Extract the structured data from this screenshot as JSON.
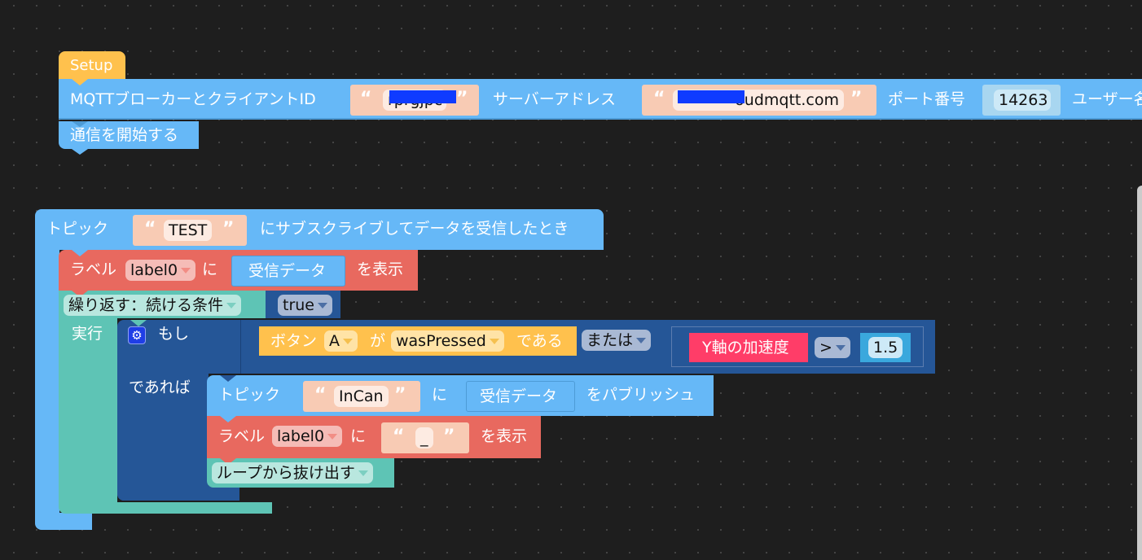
{
  "workspace": {
    "background": "#1e1e1e",
    "colors": {
      "setup": "#ffc14d",
      "mqtt": "#66b8f7",
      "label": "#e8695f",
      "loop": "#5ec4b5",
      "if": "#255697",
      "text_input": "#f8cbb4",
      "accel": "#ff3d68",
      "number": "#3aa8dd"
    }
  },
  "setup_stack": {
    "hat_label": "Setup",
    "mqtt_block": {
      "label_client_id": "MQTTブローカーとクライアントID",
      "client_id_value": "rprgjpc",
      "label_server": "サーバーアドレス",
      "server_value": "xxxxxxx.cloudmqtt.com",
      "server_visible_suffix": "oudmqtt.com",
      "label_port": "ポート番号",
      "port_value": "14263",
      "label_user": "ユーザー名"
    },
    "start_block": {
      "label": "通信を開始する"
    }
  },
  "subscribe_stack": {
    "event_block": {
      "label_prefix": "トピック",
      "topic_value": "TEST",
      "label_suffix": "にサブスクライブしてデータを受信したとき"
    },
    "show_label_1": {
      "label_prefix": "ラベル",
      "dropdown": "label0",
      "label_mid": "に",
      "value_block": "受信データ",
      "label_suffix": "を表示"
    },
    "loop_block": {
      "mode_dropdown": "繰り返す：続ける条件",
      "condition_dropdown": "true",
      "do_label": "実行"
    },
    "if_block": {
      "if_label": "もし",
      "then_label": "であれば",
      "condition": {
        "button_prefix": "ボタン",
        "button_dropdown": "A",
        "button_mid": "が",
        "state_dropdown": "wasPressed",
        "button_suffix": "である",
        "operator_dropdown": "または",
        "accel_label": "Y軸の加速度",
        "compare_dropdown": ">",
        "threshold": "1.5"
      }
    },
    "publish_block": {
      "label_prefix": "トピック",
      "topic_value": "InCan",
      "label_mid": "に",
      "value_block": "受信データ",
      "label_suffix": "をパブリッシュ"
    },
    "show_label_2": {
      "label_prefix": "ラベル",
      "dropdown": "label0",
      "label_mid": "に",
      "text_value": "_",
      "label_suffix": "を表示"
    },
    "break_block": {
      "dropdown": "ループから抜け出す"
    }
  }
}
